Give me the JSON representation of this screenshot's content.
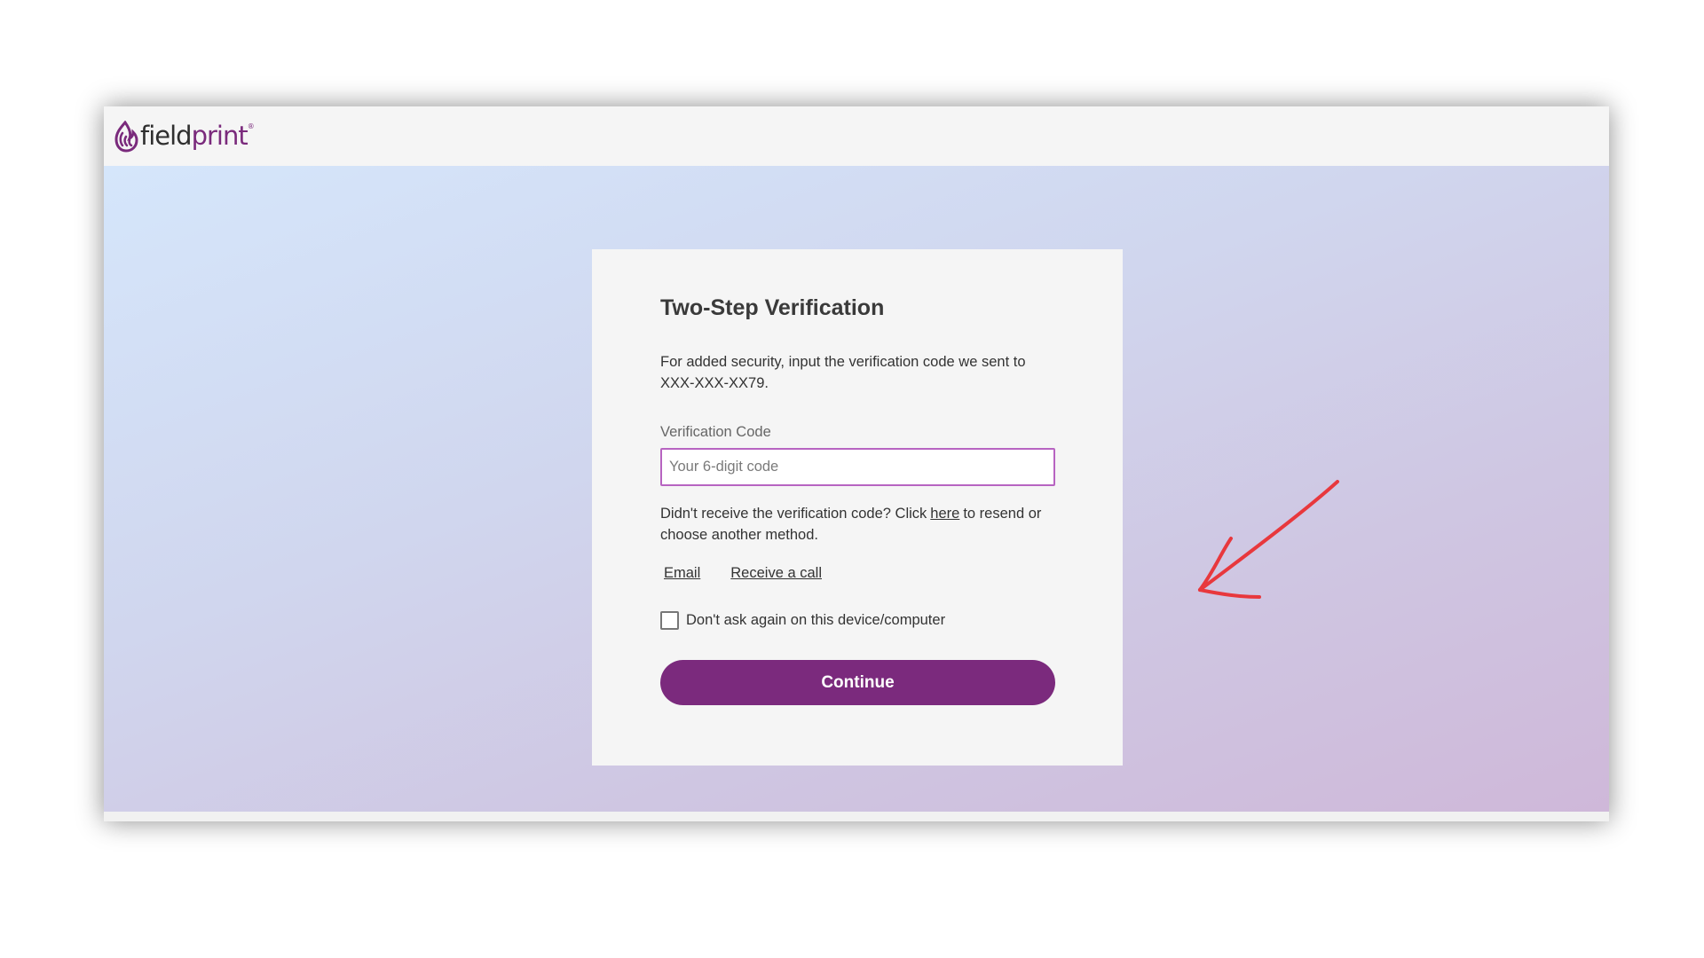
{
  "header": {
    "logo_text_field": "field",
    "logo_text_print": "print",
    "logo_tm": "®"
  },
  "card": {
    "title": "Two-Step Verification",
    "description": "For added security, input the verification code we sent to XXX-XXX-XX79.",
    "field_label": "Verification Code",
    "input_placeholder": "Your 6-digit code",
    "input_value": "",
    "resend_prefix": "Didn't receive the verification code? Click",
    "resend_link": "here",
    "resend_suffix": "to resend or choose another method.",
    "method_email": "Email",
    "method_call": "Receive a call",
    "remember_label": "Don't ask again on this device/computer",
    "remember_checked": false,
    "continue_label": "Continue"
  },
  "colors": {
    "brand_purple": "#7b2a7d",
    "input_border": "#b764c1",
    "annotation_arrow": "#e8383d"
  },
  "icons": {
    "logo": "fieldprint-flame-logo-icon",
    "arrow": "annotation-arrow-icon"
  }
}
